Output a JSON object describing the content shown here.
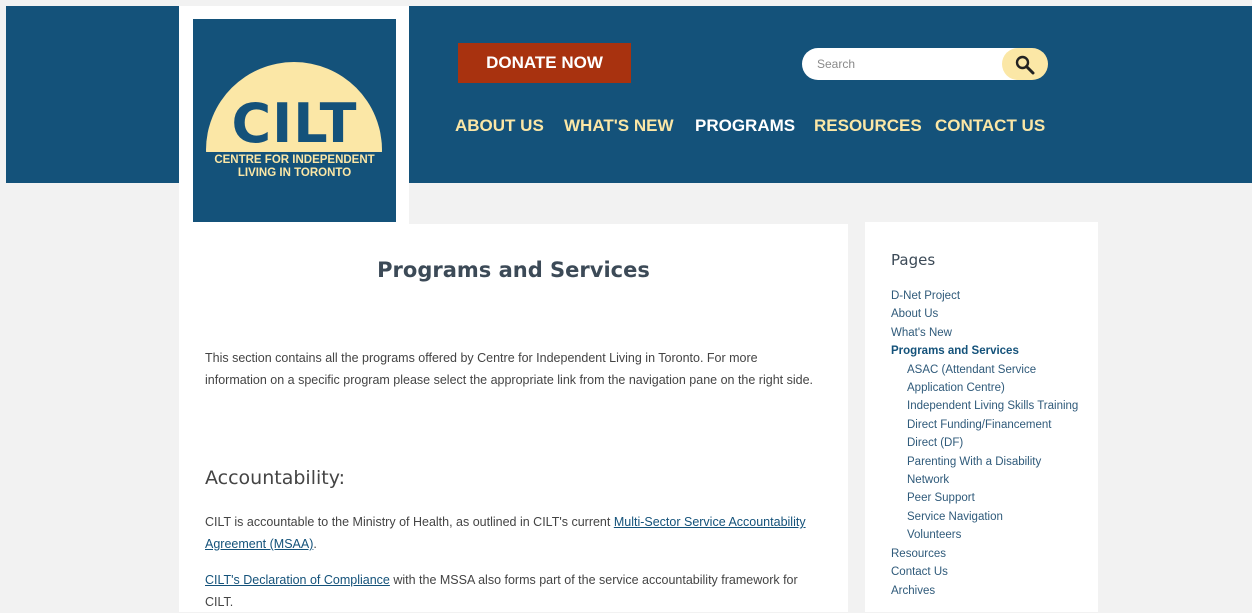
{
  "logo": {
    "word": "CILT",
    "line1": "CENTRE FOR INDEPENDENT",
    "line2": "LIVING IN TORONTO"
  },
  "header": {
    "donate_label": "DONATE NOW",
    "search_placeholder": "Search",
    "nav": [
      "ABOUT US",
      "WHAT'S NEW",
      "PROGRAMS",
      "RESOURCES",
      "CONTACT US"
    ],
    "active_nav": "PROGRAMS"
  },
  "main": {
    "title": "Programs and Services",
    "intro": "This section contains all the programs offered by Centre for Independent Living in Toronto. For more information on a specific program please select the appropriate link from the navigation pane on the right side.",
    "accountability_heading": "Accountability:",
    "p1_text": "CILT is accountable to the Ministry of Health, as outlined in CILT's current ",
    "p1_link": "Multi-Sector Service Accountability Agreement (MSAA)",
    "p1_end": ".",
    "p2_link": "CILT's Declaration of Compliance",
    "p2_text": " with the MSSA also forms part of the service accountability framework for CILT."
  },
  "sidebar": {
    "title": "Pages",
    "items": [
      "D-Net Project",
      "About Us",
      "What's New",
      "Programs and Services",
      "Resources",
      "Contact Us",
      "Archives"
    ],
    "subitems": [
      "ASAC (Attendant Service Application Centre)",
      "Independent Living Skills Training",
      "Direct Funding/Financement Direct (DF)",
      "Parenting With a Disability Network",
      "Peer Support",
      "Service Navigation",
      "Volunteers"
    ]
  },
  "colors": {
    "brand_blue": "#14527a",
    "brand_cream": "#fbe7a6",
    "donate_red": "#a8320f"
  },
  "icons": {
    "search": "search-icon"
  }
}
